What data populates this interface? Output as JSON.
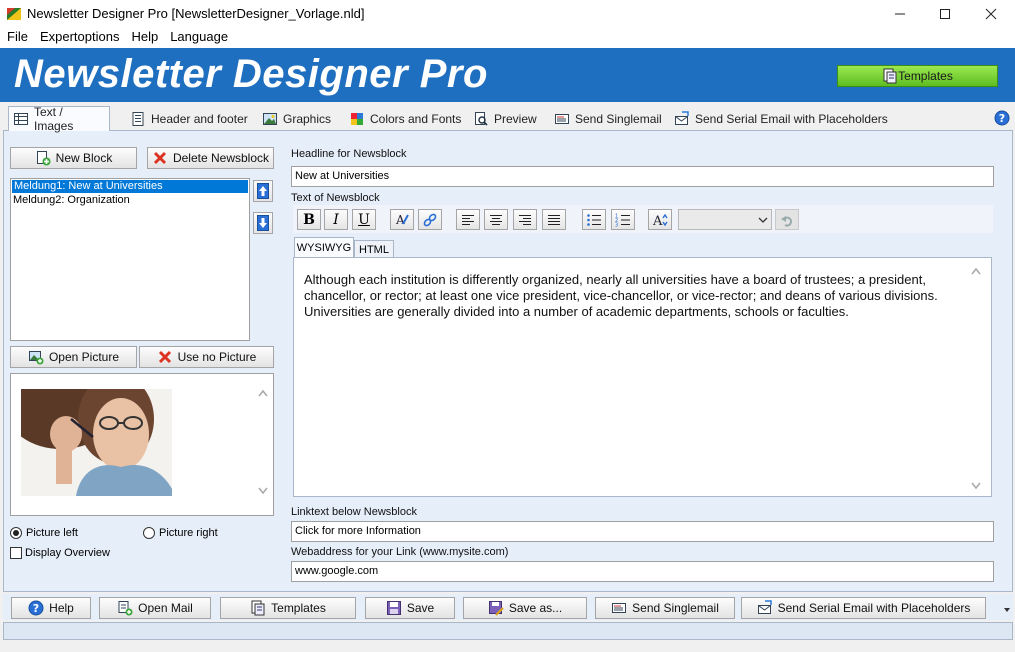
{
  "window": {
    "title": "Newsletter Designer Pro [NewsletterDesigner_Vorlage.nld]",
    "minimize": "—",
    "maximize": "☐",
    "close": "✕"
  },
  "menu": [
    {
      "label": "File"
    },
    {
      "label": "Expertoptions"
    },
    {
      "label": "Help"
    },
    {
      "label": "Language"
    }
  ],
  "banner": {
    "title": "Newsletter Designer Pro",
    "templates_button": "Templates"
  },
  "tabs": [
    {
      "label": "Text / Images",
      "icon": "table-icon"
    },
    {
      "label": "Header and footer",
      "icon": "document-icon"
    },
    {
      "label": "Graphics",
      "icon": "image-icon"
    },
    {
      "label": "Colors and Fonts",
      "icon": "palette-icon"
    },
    {
      "label": "Preview",
      "icon": "magnifier-icon"
    },
    {
      "label": "Send Singlemail",
      "icon": "mail-icon"
    },
    {
      "label": "Send Serial Email with Placeholders",
      "icon": "mail-send-icon"
    }
  ],
  "left": {
    "new_block": "New Block",
    "delete_block": "Delete Newsblock",
    "newsblocks": [
      {
        "label": "Meldung1:  New at Universities",
        "selected": true
      },
      {
        "label": "Meldung2:  Organization",
        "selected": false
      }
    ],
    "open_picture": "Open Picture",
    "use_no_picture": "Use no Picture",
    "picture_left": "Picture left",
    "picture_right": "Picture right",
    "display_overview": "Display Overview",
    "picture_position": "left",
    "display_overview_checked": false
  },
  "right": {
    "headline_label": "Headline for Newsblock",
    "headline_value": "New at Universities",
    "text_label": "Text of Newsblock",
    "toolbar": {
      "bold": "B",
      "italic": "I",
      "underline": "U",
      "font_select": ""
    },
    "subtabs": [
      "WYSIWYG",
      "HTML"
    ],
    "body_text": "Although each institution is differently organized, nearly all universities have a board of trustees; a president, chancellor, or rector; at least one vice president, vice-chancellor, or vice-rector; and deans of various divisions. Universities are generally divided into a number of academic departments, schools or faculties.",
    "linktext_label": "Linktext below Newsblock",
    "linktext_value": "Click for more Information",
    "webaddress_label": "Webaddress for your Link (www.mysite.com)",
    "webaddress_value": "www.google.com"
  },
  "bottom": {
    "help": "Help",
    "open_mail": "Open Mail",
    "templates": "Templates",
    "save": "Save",
    "save_as": "Save as...",
    "send_singlemail": "Send Singlemail",
    "send_serial": "Send Serial Email with Placeholders"
  },
  "colors": {
    "banner": "#1f6fc0",
    "templates_button": "#7ad23a",
    "selection": "#0078d7"
  }
}
